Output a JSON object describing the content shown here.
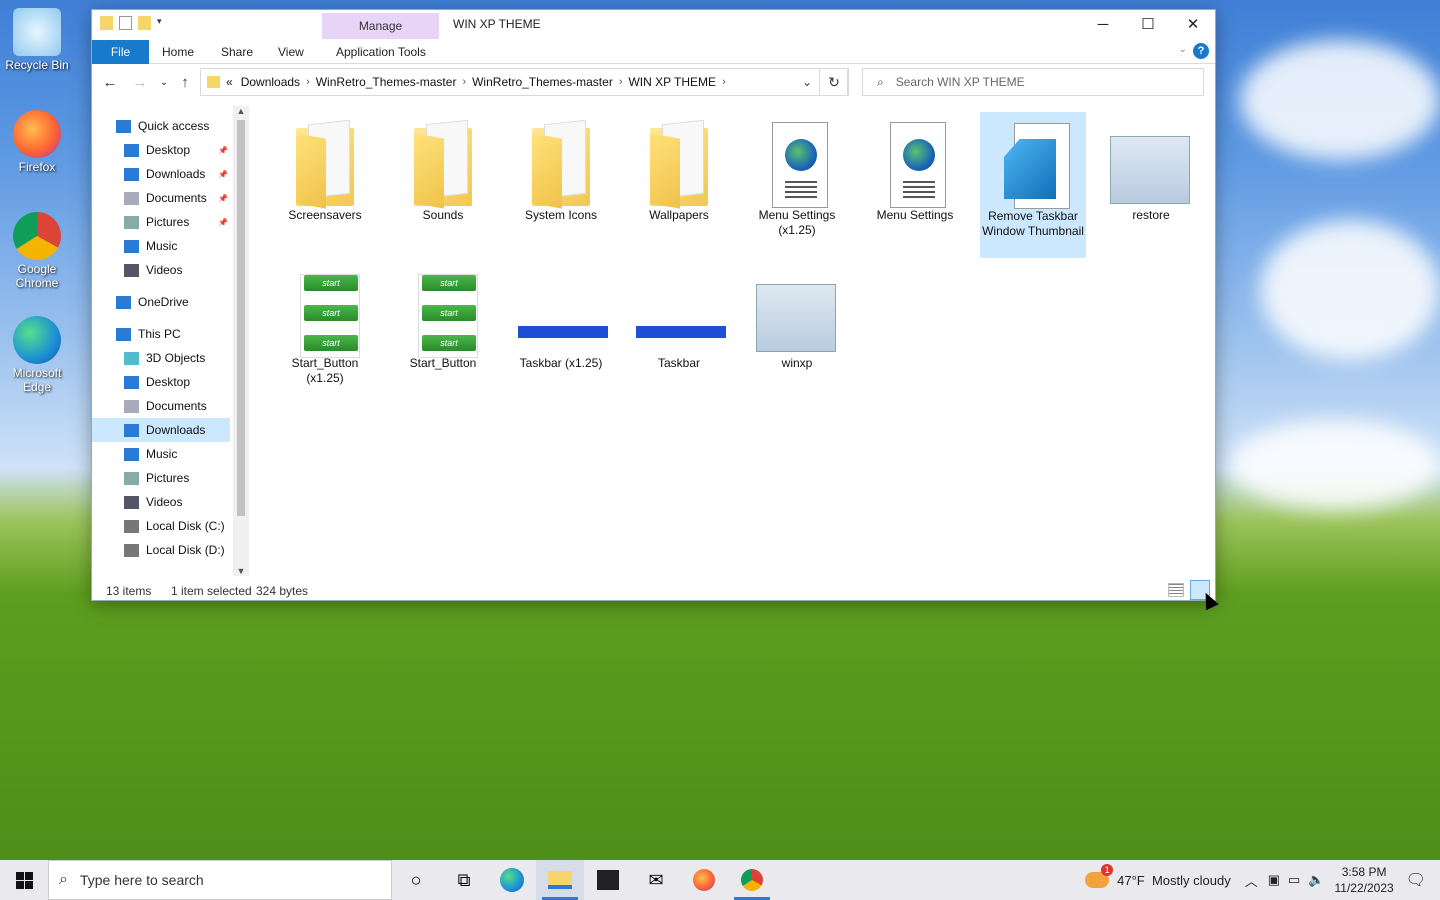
{
  "desktop": {
    "icons": [
      {
        "label": "Recycle Bin"
      },
      {
        "label": "Firefox"
      },
      {
        "label": "Google Chrome"
      },
      {
        "label": "Microsoft Edge"
      }
    ]
  },
  "window": {
    "manage_tab": "Manage",
    "title": "WIN XP THEME",
    "ribbon_tabs": [
      "File",
      "Home",
      "Share",
      "View",
      "Application Tools"
    ],
    "minimize": "─",
    "maximize": "☐",
    "close": "✕",
    "help": "?"
  },
  "address": {
    "prefix": "«",
    "crumbs": [
      "Downloads",
      "WinRetro_Themes-master",
      "WinRetro_Themes-master",
      "WIN XP THEME"
    ],
    "separator": "›"
  },
  "search": {
    "placeholder": "Search WIN XP THEME"
  },
  "navpane": {
    "items": [
      {
        "label": "Quick access",
        "icon": "star-icon"
      },
      {
        "label": "Desktop",
        "icon": "desktop-icon",
        "pinned": true
      },
      {
        "label": "Downloads",
        "icon": "download-icon",
        "pinned": true
      },
      {
        "label": "Documents",
        "icon": "documents-icon",
        "pinned": true
      },
      {
        "label": "Pictures",
        "icon": "pictures-icon",
        "pinned": true
      },
      {
        "label": "Music",
        "icon": "music-icon"
      },
      {
        "label": "Videos",
        "icon": "videos-icon"
      },
      {
        "label": "OneDrive",
        "icon": "cloud-icon"
      },
      {
        "label": "This PC",
        "icon": "pc-icon"
      },
      {
        "label": "3D Objects",
        "icon": "cube-icon"
      },
      {
        "label": "Desktop",
        "icon": "desktop-icon"
      },
      {
        "label": "Documents",
        "icon": "documents-icon"
      },
      {
        "label": "Downloads",
        "icon": "download-icon",
        "selected": true
      },
      {
        "label": "Music",
        "icon": "music-icon"
      },
      {
        "label": "Pictures",
        "icon": "pictures-icon"
      },
      {
        "label": "Videos",
        "icon": "videos-icon"
      },
      {
        "label": "Local Disk (C:)",
        "icon": "disk-icon"
      },
      {
        "label": "Local Disk (D:)",
        "icon": "disk-icon"
      }
    ]
  },
  "files": [
    {
      "name": "Screensavers",
      "kind": "folder"
    },
    {
      "name": "Sounds",
      "kind": "folder"
    },
    {
      "name": "System Icons",
      "kind": "folder"
    },
    {
      "name": "Wallpapers",
      "kind": "folder"
    },
    {
      "name": "Menu Settings (x1.25)",
      "kind": "reg-doc"
    },
    {
      "name": "Menu Settings",
      "kind": "reg-doc"
    },
    {
      "name": "Remove Taskbar Window Thumbnail",
      "kind": "regedit",
      "selected": true
    },
    {
      "name": "restore",
      "kind": "zip"
    },
    {
      "name": "Start_Button (x1.25)",
      "kind": "start-image"
    },
    {
      "name": "Start_Button",
      "kind": "start-image"
    },
    {
      "name": "Taskbar (x1.25)",
      "kind": "taskbar-image"
    },
    {
      "name": "Taskbar",
      "kind": "taskbar-image"
    },
    {
      "name": "winxp",
      "kind": "zip"
    }
  ],
  "start_label": "start",
  "status": {
    "items": "13 items",
    "selected": "1 item selected",
    "size": "324 bytes"
  },
  "taskbar": {
    "search_placeholder": "Type here to search",
    "weather": "47°F  Mostly cloudy",
    "time": "3:58 PM",
    "date": "11/22/2023",
    "notif_count": "1"
  }
}
